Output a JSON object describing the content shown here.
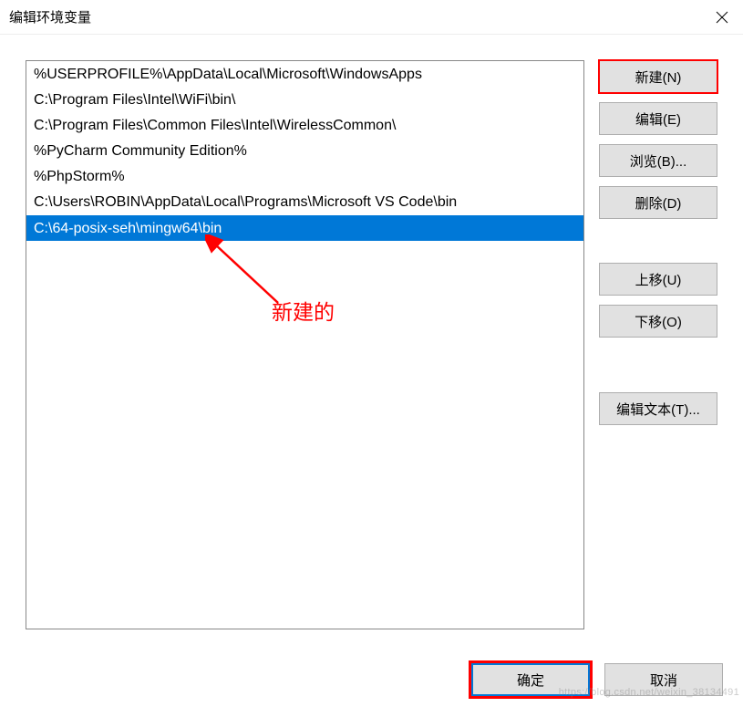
{
  "window": {
    "title": "编辑环境变量"
  },
  "list": {
    "items": [
      {
        "text": "%USERPROFILE%\\AppData\\Local\\Microsoft\\WindowsApps",
        "selected": false
      },
      {
        "text": "C:\\Program Files\\Intel\\WiFi\\bin\\",
        "selected": false
      },
      {
        "text": "C:\\Program Files\\Common Files\\Intel\\WirelessCommon\\",
        "selected": false
      },
      {
        "text": "%PyCharm Community Edition%",
        "selected": false
      },
      {
        "text": "%PhpStorm%",
        "selected": false
      },
      {
        "text": "C:\\Users\\ROBIN\\AppData\\Local\\Programs\\Microsoft VS Code\\bin",
        "selected": false
      },
      {
        "text": "C:\\64-posix-seh\\mingw64\\bin",
        "selected": true
      }
    ]
  },
  "buttons": {
    "new": "新建(N)",
    "edit": "编辑(E)",
    "browse": "浏览(B)...",
    "delete": "删除(D)",
    "moveup": "上移(U)",
    "movedown": "下移(O)",
    "edittext": "编辑文本(T)...",
    "ok": "确定",
    "cancel": "取消"
  },
  "annotation": {
    "label": "新建的"
  },
  "watermark": "https://blog.csdn.net/weixin_38134491"
}
